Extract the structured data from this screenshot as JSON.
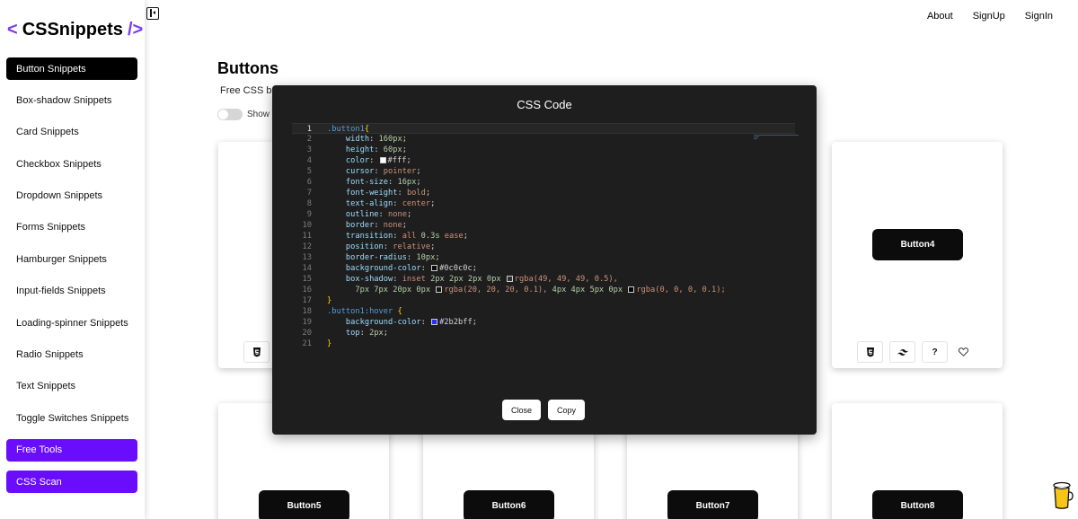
{
  "brand": {
    "open": "<",
    "name": "CSSnippets",
    "close": "/>"
  },
  "nav": {
    "about": "About",
    "signup": "SignUp",
    "signin": "SignIn"
  },
  "sidebar": {
    "items": [
      {
        "label": "Button Snippets",
        "active": true
      },
      {
        "label": "Box-shadow Snippets"
      },
      {
        "label": "Card Snippets"
      },
      {
        "label": "Checkbox Snippets"
      },
      {
        "label": "Dropdown Snippets"
      },
      {
        "label": "Forms Snippets"
      },
      {
        "label": "Hamburger Snippets"
      },
      {
        "label": "Input-fields Snippets"
      },
      {
        "label": "Loading-spinner Snippets"
      },
      {
        "label": "Radio Snippets"
      },
      {
        "label": "Text Snippets"
      },
      {
        "label": "Toggle Switches Snippets"
      }
    ],
    "tools": [
      {
        "label": "Free Tools"
      },
      {
        "label": "CSS Scan"
      }
    ]
  },
  "main": {
    "title": "Buttons",
    "subtitle_visible": "Free CSS bu",
    "toggle_label_visible": "Show T",
    "cards": [
      {
        "label": "Button4"
      },
      {
        "label": "Button5"
      },
      {
        "label": "Button6"
      },
      {
        "label": "Button7"
      },
      {
        "label": "Button8"
      }
    ],
    "card_actions": {
      "html_icon": "html5-icon",
      "tailwind_icon": "tailwind-icon",
      "help_label": "?",
      "fav_icon": "heart-icon"
    }
  },
  "modal": {
    "title": "CSS Code",
    "close_label": "Close",
    "copy_label": "Copy",
    "code": {
      "l1_sel": ".button1",
      "l1_brace": "{",
      "l2_prop": "width",
      "l2_val": "160px",
      "l3_prop": "height",
      "l3_val": "60px",
      "l4_prop": "color",
      "l4_val": "#fff",
      "l5_prop": "cursor",
      "l5_val": "pointer",
      "l6_prop": "font-size",
      "l6_val": "16px",
      "l7_prop": "font-weight",
      "l7_val": "bold",
      "l8_prop": "text-align",
      "l8_val": "center",
      "l9_prop": "outline",
      "l9_val": "none",
      "l10_prop": "border",
      "l10_val": "none",
      "l11_prop": "transition",
      "l11_kw": "all",
      "l11_num": "0.3s",
      "l11_val": "ease",
      "l12_prop": "position",
      "l12_val": "relative",
      "l13_prop": "border-radius",
      "l13_val": "10px",
      "l14_prop": "background-color",
      "l14_val": "#0c0c0c",
      "l15_prop": "box-shadow",
      "l15_kw": "inset",
      "l15_nums": "2px 2px 2px 0px",
      "l15_rgba": "rgba(49, 49, 49, 0.5),",
      "l16_nums1": "7px 7px 20px 0px",
      "l16_rgba1": "rgba(20, 20, 20, 0.1),",
      "l16_nums2": "4px 4px 5px 0px",
      "l16_rgba2": "rgba(0, 0, 0, 0.1);",
      "l17": "}",
      "l18_sel": ".button1:hover",
      "l18_brace": "{",
      "l19_prop": "background-color",
      "l19_val": "#2b2bff",
      "l20_prop": "top",
      "l20_val": "2px",
      "l21": "}"
    },
    "swatches": {
      "white": "#ffffff",
      "dark": "#0c0c0c",
      "shadow1": "#313131",
      "shadow2": "#141414",
      "shadow3": "#000000",
      "blue": "#2b2bff"
    }
  },
  "colors": {
    "accent": "#6a0dfc",
    "brand_bracket": "#7c3aed",
    "modal_bg": "#1e1e1e",
    "button_bg": "#0c0c0c"
  }
}
